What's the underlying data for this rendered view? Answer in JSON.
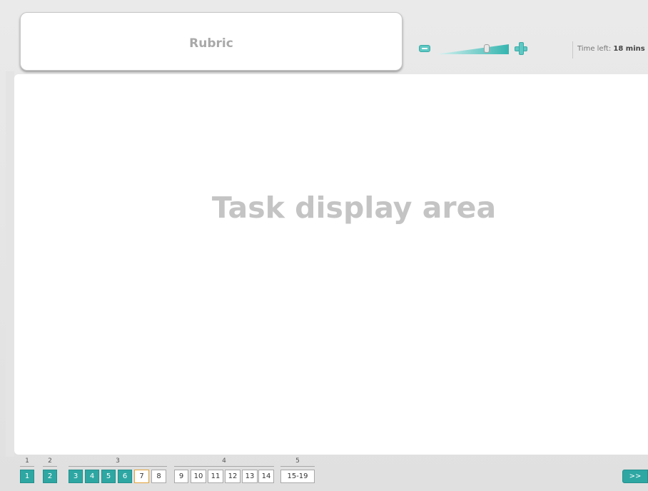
{
  "header": {
    "rubric_label": "Rubric",
    "time_left_label": "Time left:",
    "time_left_value": "18 mins"
  },
  "zoom": {
    "level": 0.7
  },
  "main": {
    "placeholder": "Task display area"
  },
  "navigation": {
    "groups": [
      {
        "label": "1",
        "items": [
          {
            "label": "1",
            "state": "done"
          }
        ]
      },
      {
        "label": "2",
        "items": [
          {
            "label": "2",
            "state": "done"
          }
        ]
      },
      {
        "label": "3",
        "items": [
          {
            "label": "3",
            "state": "done"
          },
          {
            "label": "4",
            "state": "done"
          },
          {
            "label": "5",
            "state": "done"
          },
          {
            "label": "6",
            "state": "done"
          },
          {
            "label": "7",
            "state": "current"
          },
          {
            "label": "8",
            "state": "pending"
          }
        ]
      },
      {
        "label": "4",
        "items": [
          {
            "label": "9",
            "state": "pending"
          },
          {
            "label": "10",
            "state": "pending"
          },
          {
            "label": "11",
            "state": "pending"
          },
          {
            "label": "12",
            "state": "pending"
          },
          {
            "label": "13",
            "state": "pending"
          },
          {
            "label": "14",
            "state": "pending"
          }
        ]
      },
      {
        "label": "5",
        "items": [
          {
            "label": "15-19",
            "state": "pending"
          }
        ]
      }
    ],
    "next_label": ">>"
  },
  "colors": {
    "accent": "#2ea7a3",
    "current_outline": "#e2a33a",
    "placeholder_text": "#c4c4c4"
  }
}
